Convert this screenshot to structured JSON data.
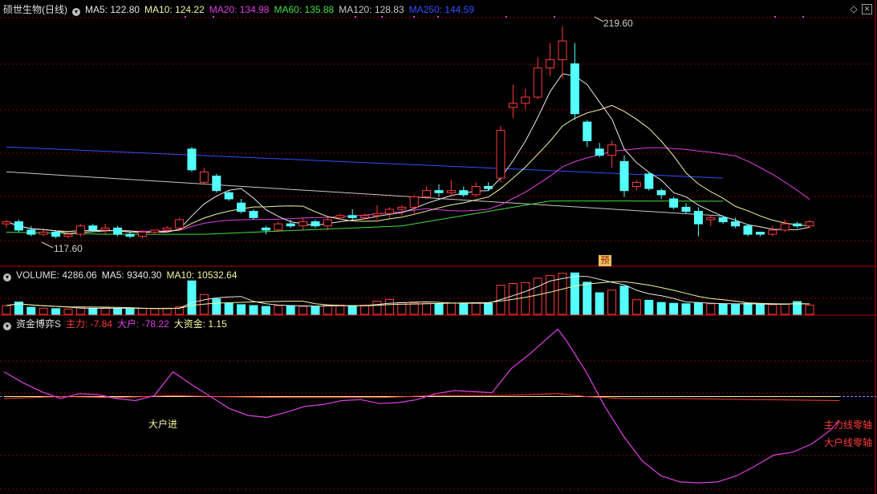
{
  "header": {
    "title": "硕世生物(日线)",
    "ma": [
      {
        "text": "MA5: 122.80",
        "color": "#e8e8e8"
      },
      {
        "text": "MA10: 124.22",
        "color": "#f5f5a0"
      },
      {
        "text": "MA20: 134.98",
        "color": "#e040e0"
      },
      {
        "text": "MA60: 135.88",
        "color": "#40e040"
      },
      {
        "text": "MA120: 128.83",
        "color": "#c8c8c8"
      },
      {
        "text": "MA250: 144.59",
        "color": "#3050ff"
      }
    ]
  },
  "volume_header": {
    "title": "VOLUME: 4286.06",
    "ma5": "MA5: 9340.30",
    "ma10": "MA10: 10532.64"
  },
  "indicator_header": {
    "title": "资金博弈S",
    "main": "主力: -7.84",
    "big": "大户: -78.22",
    "fund": "大资金: 1.15"
  },
  "annotations": {
    "high": "219.60",
    "low": "117.60",
    "yu": "预",
    "dahujin": "大户进",
    "right1": "主力线零轴",
    "right2": "大户线零轴"
  },
  "colors": {
    "up": "#ff3c3c",
    "down": "#54ffff",
    "grid": "#8a0000",
    "panel_border": "#c00000",
    "ma5": "#e8e8e8",
    "ma10": "#f5f5a0",
    "ma20": "#e040e0",
    "ma60": "#40e040",
    "ma120": "#c8c8c8",
    "ma250": "#3050ff",
    "big": "#e040e0",
    "main": "#ff3c3c",
    "fund": "#f5f5a0"
  },
  "chart_data": {
    "type": "candlestick",
    "price_range": [
      110,
      225
    ],
    "ma250": [
      [
        0,
        162
      ],
      [
        58,
        147
      ]
    ],
    "ma120": [
      [
        0,
        150
      ],
      [
        58,
        128.8
      ]
    ],
    "ma60": [
      [
        0,
        121
      ],
      [
        8,
        120
      ],
      [
        16,
        120
      ],
      [
        24,
        122
      ],
      [
        32,
        124
      ],
      [
        40,
        132
      ],
      [
        44,
        136
      ],
      [
        50,
        136
      ],
      [
        58,
        135.9
      ]
    ],
    "candles": [
      [
        125,
        127,
        123,
        126
      ],
      [
        126,
        127,
        121,
        122
      ],
      [
        122,
        124,
        119,
        120
      ],
      [
        120,
        122,
        119,
        121
      ],
      [
        121,
        122,
        118,
        119
      ],
      [
        119,
        121,
        118,
        120
      ],
      [
        120,
        125,
        119,
        124
      ],
      [
        124,
        125,
        121,
        122
      ],
      [
        122,
        125,
        120,
        123
      ],
      [
        123,
        124,
        119,
        120
      ],
      [
        120,
        121,
        118,
        119
      ],
      [
        119,
        122,
        118,
        121
      ],
      [
        121,
        122,
        120,
        122
      ],
      [
        122,
        124,
        121,
        123
      ],
      [
        123,
        128,
        122,
        127
      ],
      [
        161,
        162,
        150,
        151
      ],
      [
        145,
        152,
        144,
        150
      ],
      [
        148,
        149,
        140,
        141
      ],
      [
        140,
        141,
        136,
        137
      ],
      [
        135,
        137,
        130,
        131
      ],
      [
        131,
        132,
        127,
        128
      ],
      [
        123,
        124,
        120,
        122
      ],
      [
        122,
        126,
        121,
        125
      ],
      [
        125,
        127,
        123,
        124
      ],
      [
        124,
        128,
        122,
        126
      ],
      [
        126,
        127,
        123,
        124
      ],
      [
        124,
        128,
        122,
        127
      ],
      [
        128,
        130,
        127,
        129
      ],
      [
        129,
        132,
        127,
        128
      ],
      [
        128,
        130,
        127,
        129
      ],
      [
        129,
        134,
        127,
        130
      ],
      [
        130,
        133,
        128,
        132
      ],
      [
        132,
        134,
        129,
        133
      ],
      [
        133,
        139,
        130,
        138
      ],
      [
        138,
        143,
        137,
        141
      ],
      [
        141,
        144,
        138,
        140
      ],
      [
        140,
        146,
        138,
        141
      ],
      [
        141,
        143,
        138,
        139
      ],
      [
        139,
        145,
        138,
        143
      ],
      [
        143,
        145,
        141,
        142
      ],
      [
        147,
        172,
        145,
        170
      ],
      [
        181,
        192,
        176,
        183
      ],
      [
        183,
        190,
        180,
        186
      ],
      [
        186,
        205,
        185,
        200
      ],
      [
        200,
        212,
        196,
        204
      ],
      [
        204,
        220,
        195,
        213
      ],
      [
        202,
        212,
        175,
        178
      ],
      [
        174,
        175,
        162,
        165
      ],
      [
        161,
        164,
        157,
        158
      ],
      [
        158,
        165,
        152,
        163
      ],
      [
        155,
        158,
        138,
        141
      ],
      [
        143,
        146,
        141,
        145
      ],
      [
        149,
        150,
        141,
        142
      ],
      [
        141,
        142,
        137,
        139
      ],
      [
        137,
        138,
        132,
        133
      ],
      [
        133,
        135,
        130,
        131
      ],
      [
        131,
        133,
        119,
        125
      ],
      [
        127,
        129,
        124,
        128
      ],
      [
        128,
        129,
        125,
        126
      ],
      [
        126,
        128,
        123,
        124
      ],
      [
        124,
        125,
        119,
        120
      ],
      [
        121,
        121,
        119,
        120
      ],
      [
        120,
        124,
        119,
        122
      ],
      [
        122,
        127,
        121,
        125
      ],
      [
        125,
        126,
        123,
        124
      ],
      [
        124,
        127,
        123,
        126
      ]
    ],
    "volume_range": [
      0,
      8000
    ],
    "volume": [
      2000,
      2800,
      1600,
      1400,
      1300,
      1200,
      1500,
      1400,
      1500,
      1300,
      1200,
      1400,
      1300,
      1400,
      1700,
      7600,
      4500,
      3500,
      2500,
      2200,
      2000,
      1800,
      2000,
      2000,
      1800,
      1800,
      2000,
      2100,
      2000,
      2100,
      3000,
      3400,
      2700,
      2600,
      2500,
      2400,
      2600,
      2500,
      2600,
      2500,
      6600,
      7000,
      7200,
      8200,
      8800,
      9300,
      9400,
      7300,
      4900,
      5500,
      6400,
      3300,
      3200,
      2700,
      2500,
      2400,
      2600,
      2400,
      2300,
      2200,
      2500,
      2300,
      2200,
      2300,
      2900,
      2100
    ],
    "indicator_range": [
      -95,
      70
    ],
    "big": [
      [
        0,
        25
      ],
      [
        2,
        14
      ],
      [
        4,
        5
      ],
      [
        6,
        -2
      ],
      [
        8,
        3
      ],
      [
        10,
        2
      ],
      [
        12,
        -2
      ],
      [
        14,
        -4
      ],
      [
        16,
        1
      ],
      [
        18,
        25
      ],
      [
        20,
        12
      ],
      [
        22,
        0
      ],
      [
        24,
        -12
      ],
      [
        26,
        -19
      ],
      [
        28,
        -21
      ],
      [
        30,
        -16
      ],
      [
        32,
        -10
      ],
      [
        34,
        -8
      ],
      [
        36,
        -4
      ],
      [
        38,
        -3
      ],
      [
        40,
        -7
      ],
      [
        42,
        -6
      ],
      [
        44,
        -3
      ],
      [
        46,
        3
      ],
      [
        48,
        6
      ],
      [
        50,
        5
      ],
      [
        52,
        4
      ],
      [
        54,
        28
      ],
      [
        56,
        43
      ],
      [
        58,
        60
      ],
      [
        59,
        68
      ],
      [
        60,
        55
      ],
      [
        62,
        25
      ],
      [
        64,
        -10
      ],
      [
        66,
        -40
      ],
      [
        68,
        -65
      ],
      [
        70,
        -80
      ],
      [
        72,
        -86
      ],
      [
        74,
        -87
      ],
      [
        76,
        -86
      ],
      [
        78,
        -80
      ],
      [
        80,
        -70
      ],
      [
        82,
        -59
      ],
      [
        84,
        -56
      ],
      [
        86,
        -48
      ],
      [
        88,
        -34
      ],
      [
        89,
        -24
      ]
    ],
    "main": [
      [
        0,
        -2
      ],
      [
        6,
        0
      ],
      [
        12,
        -1
      ],
      [
        18,
        1
      ],
      [
        22,
        0
      ],
      [
        30,
        -1
      ],
      [
        40,
        -1
      ],
      [
        46,
        1
      ],
      [
        52,
        1
      ],
      [
        56,
        2
      ],
      [
        59,
        3
      ],
      [
        62,
        0
      ],
      [
        66,
        -2
      ],
      [
        72,
        -2
      ],
      [
        80,
        -3
      ],
      [
        89,
        -4
      ]
    ],
    "fund": [
      [
        0,
        0
      ],
      [
        89,
        0
      ]
    ]
  }
}
